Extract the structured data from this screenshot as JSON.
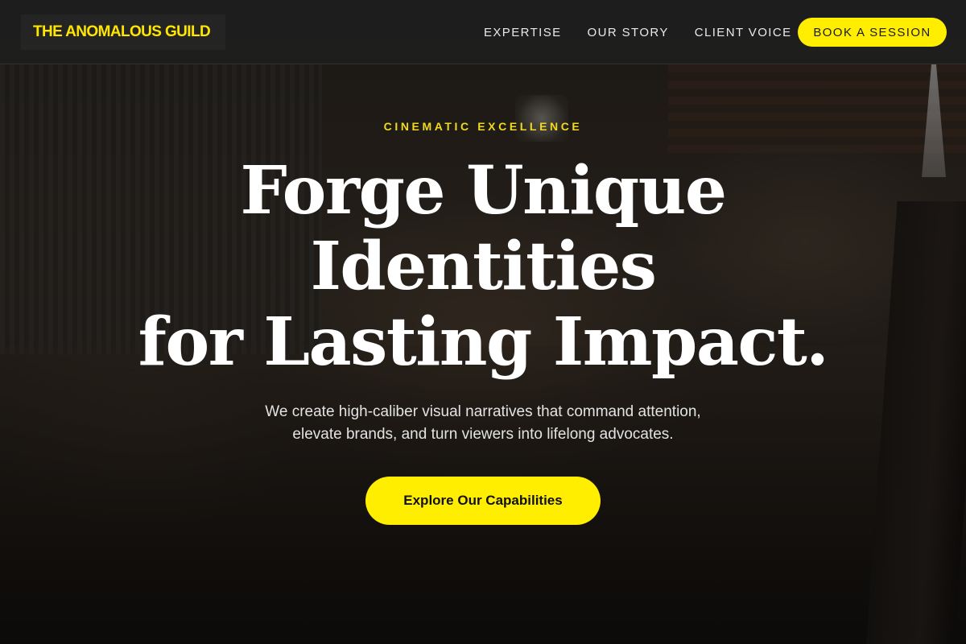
{
  "header": {
    "logo": "THE ANOMALOUS GUILD",
    "nav": [
      "EXPERTISE",
      "OUR STORY",
      "CLIENT VOICE"
    ],
    "cta": "BOOK A SESSION"
  },
  "hero": {
    "eyebrow": "CINEMATIC EXCELLENCE",
    "headline": [
      "Forge Unique",
      "Identities",
      "for Lasting Impact."
    ],
    "subtitle_lines": [
      "We create high-caliber visual narratives that command attention,",
      "elevate brands, and turn viewers into lifelong advocates."
    ],
    "cta": "Explore Our Capabilities"
  },
  "colors": {
    "accent": "#ffee00",
    "eyebrow": "#f2d91d",
    "header_bg": "#1e1e1e"
  }
}
